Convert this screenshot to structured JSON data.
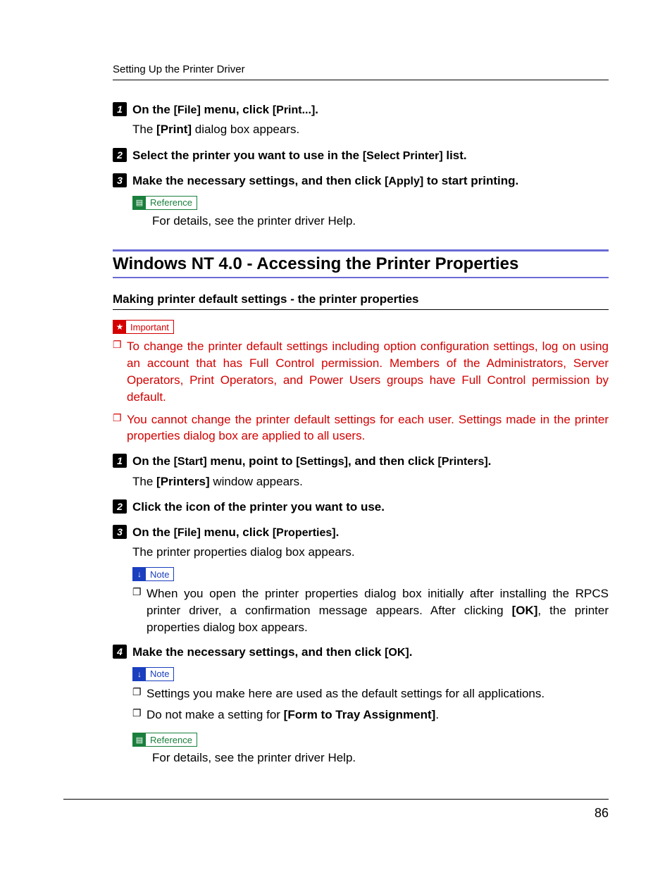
{
  "running_head": "Setting Up the Printer Driver",
  "page_number": "86",
  "callout_labels": {
    "reference": "Reference",
    "note": "Note",
    "important": "Important"
  },
  "top_steps": {
    "s1": {
      "num": "1",
      "pre": "On the ",
      "ui1": "[File]",
      "mid": " menu, click ",
      "ui2": "[Print...]",
      "post": ".",
      "body_pre": "The ",
      "body_ui": "[Print]",
      "body_post": " dialog box appears."
    },
    "s2": {
      "num": "2",
      "pre": "Select the printer you want to use in the ",
      "ui1": "[Select Printer]",
      "post": " list."
    },
    "s3": {
      "num": "3",
      "pre": "Make the necessary settings, and then click ",
      "ui1": "[Apply]",
      "post": " to start printing."
    },
    "ref_body": "For details, see the printer driver Help."
  },
  "section_heading": "Windows NT 4.0 - Accessing the Printer Properties",
  "subheading": "Making printer default settings - the printer properties",
  "important_items": [
    "To change the printer default settings including option configuration settings, log on using an account that has Full Control permission. Members of the Administrators, Server Operators, Print Operators, and Power Users groups have Full Control permission by default.",
    "You cannot change the printer default settings for each user. Settings made in the printer properties dialog box are applied to all users."
  ],
  "nt_steps": {
    "s1": {
      "num": "1",
      "pre": "On the ",
      "ui1": "[Start]",
      "mid1": " menu, point to ",
      "ui2": "[Settings]",
      "mid2": ", and then click ",
      "ui3": "[Printers]",
      "post": ".",
      "body_pre": "The ",
      "body_ui": "[Printers]",
      "body_post": " window appears."
    },
    "s2": {
      "num": "2",
      "title": "Click the icon of the printer you want to use."
    },
    "s3": {
      "num": "3",
      "pre": "On the ",
      "ui1": "[File]",
      "mid": " menu, click ",
      "ui2": "[Properties]",
      "post": ".",
      "body": "The printer properties dialog box appears.",
      "note_pre": "When you open the printer properties dialog box initially after installing the RPCS printer driver, a confirmation message appears. After clicking ",
      "note_ui": "[OK]",
      "note_post": ", the printer properties dialog box appears."
    },
    "s4": {
      "num": "4",
      "pre": "Make the necessary settings, and then click ",
      "ui1": "[OK]",
      "post": ".",
      "note1": "Settings you make here are used as the default settings for all applications.",
      "note2_pre": "Do not make a setting for ",
      "note2_ui": "[Form to Tray Assignment]",
      "note2_post": ".",
      "ref_body": "For details, see the printer driver Help."
    }
  }
}
